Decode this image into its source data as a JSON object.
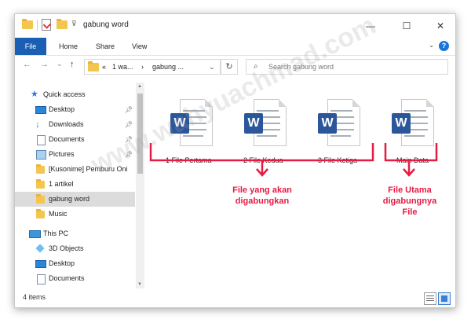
{
  "window": {
    "title": "gabung word"
  },
  "window_controls": {
    "minimize": "—",
    "maximize": "☐",
    "close": "✕"
  },
  "ribbon": {
    "tabs": [
      "File",
      "Home",
      "Share",
      "View"
    ],
    "help": "?"
  },
  "nav": {
    "back": "←",
    "forward": "→",
    "dropdown": "⌄",
    "up": "↑",
    "address_parts": [
      "«",
      "1 wa...",
      "›",
      "gabung ..."
    ],
    "refresh": "↻",
    "search_placeholder": "Search gabung word"
  },
  "sidebar": {
    "items": [
      {
        "label": "Quick access",
        "icon": "star-icon"
      },
      {
        "label": "Desktop",
        "icon": "desktop-icon",
        "pinned": true
      },
      {
        "label": "Downloads",
        "icon": "download-icon",
        "pinned": true
      },
      {
        "label": "Documents",
        "icon": "documents-icon",
        "pinned": true
      },
      {
        "label": "Pictures",
        "icon": "pictures-icon",
        "pinned": true
      },
      {
        "label": "[Kusonime] Pemburu Oni",
        "icon": "folder-icon"
      },
      {
        "label": "1 artikel",
        "icon": "folder-icon"
      },
      {
        "label": "gabung word",
        "icon": "folder-icon",
        "selected": true
      },
      {
        "label": "Music",
        "icon": "folder-icon"
      },
      {
        "label": "This PC",
        "icon": "computer-icon"
      },
      {
        "label": "3D Objects",
        "icon": "cube-icon"
      },
      {
        "label": "Desktop",
        "icon": "desktop-icon"
      },
      {
        "label": "Documents",
        "icon": "documents-icon"
      }
    ]
  },
  "files": [
    {
      "name": "1 File Pertama"
    },
    {
      "name": "2 File Kedua"
    },
    {
      "name": "3 File Ketiga"
    },
    {
      "name": "Main Data"
    }
  ],
  "annotations": {
    "left": [
      "File yang akan",
      "digabungkan"
    ],
    "right": [
      "File Utama",
      "digabungnya",
      "File"
    ],
    "color": "#e61b43"
  },
  "watermark": "www.wahyuachmad.com",
  "status": {
    "items_count": "4 items"
  },
  "colors": {
    "accent": "#1a5fb4",
    "word": "#2b579a",
    "folder": "#f3c74f"
  }
}
